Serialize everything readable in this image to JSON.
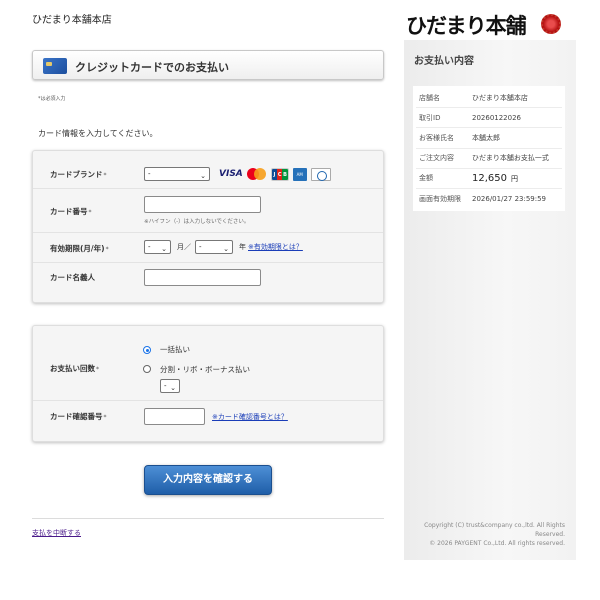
{
  "header": {
    "shop_name": "ひだまり本舗本店"
  },
  "logo": {
    "text": "ひだまり本舗"
  },
  "page": {
    "title": "クレジットカードでのお支払い",
    "required_note": "*は必須入力",
    "instruction": "カード情報を入力してください。"
  },
  "card_form": {
    "brand_label": "カードブランド",
    "brand_value": "-",
    "brand_logos": [
      "VISA",
      "Mastercard",
      "JCB",
      "American Express",
      "Diners Club"
    ],
    "number_label": "カード番号",
    "number_hint": "※ハイフン（-）は入力しないでください。",
    "number_value": "",
    "expiry_label": "有効期限(月/年)",
    "expiry_month_value": "-",
    "expiry_month_unit": "月／",
    "expiry_year_value": "-",
    "expiry_year_unit": "年",
    "expiry_help_link": "※有効期限とは？",
    "name_label": "カード名義人",
    "name_value": "",
    "required_mark": "*"
  },
  "payment_form": {
    "installments_label": "お支払い回数",
    "option_lump_sum": "一括払い",
    "option_split": "分割・リボ・ボーナス払い",
    "split_select_value": "-",
    "selected_option": "一括払い",
    "cvv_label": "カード確認番号",
    "cvv_value": "",
    "cvv_help_link": "※カード確認番号とは？",
    "required_mark": "*"
  },
  "actions": {
    "confirm_label": "入力内容を確認する",
    "cancel_label": "支払を中断する"
  },
  "sidebar": {
    "heading": "お支払い内容",
    "rows": [
      {
        "label": "店舗名",
        "value": "ひだまり本舗本店"
      },
      {
        "label": "取引ID",
        "value": "20260122026"
      },
      {
        "label": "お客様氏名",
        "value": "本舗太郎"
      },
      {
        "label": "ご注文内容",
        "value": "ひだまり本舗お支払一式"
      },
      {
        "label": "金額",
        "value": "12,650",
        "unit": "円"
      },
      {
        "label": "画面有効期限",
        "value": "2026/01/27 23:59:59"
      }
    ],
    "copyright_1": "Copyright (C) trust&company co.,ltd. All Rights Reserved.",
    "copyright_2": "© 2026 PAYGENT Co.,Ltd. All rights reserved."
  },
  "colors": {
    "primary_button": "#1f5ea8",
    "link": "#1a3db8",
    "radio_selected": "#1a73e8"
  }
}
